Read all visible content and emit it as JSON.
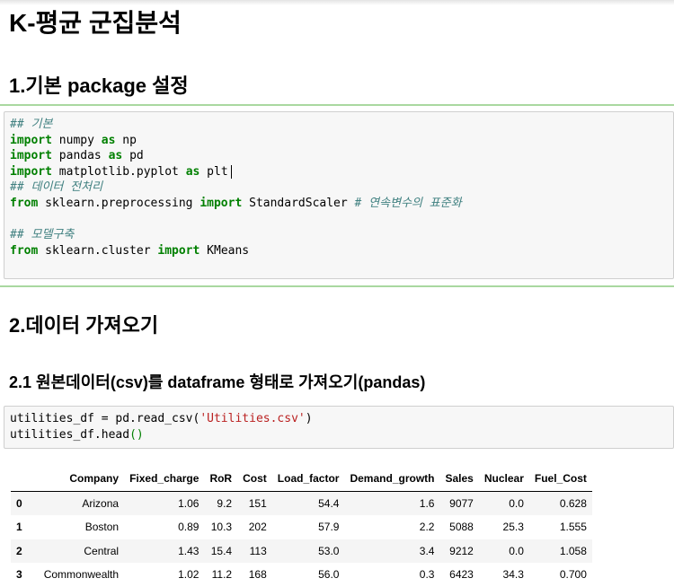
{
  "title": "K-평균 군집분석",
  "section1": {
    "heading": "1.기본 package 설정",
    "code": {
      "comment_basic": "## 기본",
      "line_numpy": [
        {
          "t": "import",
          "c": "kw"
        },
        {
          "t": " numpy "
        },
        {
          "t": "as",
          "c": "kw"
        },
        {
          "t": " np"
        }
      ],
      "line_pandas": [
        {
          "t": "import",
          "c": "kw"
        },
        {
          "t": " pandas "
        },
        {
          "t": "as",
          "c": "kw"
        },
        {
          "t": " pd"
        }
      ],
      "line_plt": [
        {
          "t": "import",
          "c": "kw"
        },
        {
          "t": " matplotlib.pyplot "
        },
        {
          "t": "as",
          "c": "kw"
        },
        {
          "t": " plt"
        }
      ],
      "comment_preprocess": "## 데이터 전처리",
      "line_scaler": [
        {
          "t": "from",
          "c": "kw"
        },
        {
          "t": " sklearn.preprocessing "
        },
        {
          "t": "import",
          "c": "kw"
        },
        {
          "t": " StandardScaler "
        },
        {
          "t": "# 연속변수의 표준화",
          "c": "cm"
        }
      ],
      "comment_model": "## 모델구축",
      "line_kmeans": [
        {
          "t": "from",
          "c": "kw"
        },
        {
          "t": " sklearn.cluster "
        },
        {
          "t": "import",
          "c": "kw"
        },
        {
          "t": " KMeans"
        }
      ]
    }
  },
  "section2": {
    "heading": "2.데이터 가져오기",
    "subheading": "2.1 원본데이터(csv)를 dataframe 형태로 가져오기(pandas)",
    "code": {
      "line_read": [
        {
          "t": "utilities_df = pd.read_csv("
        },
        {
          "t": "'Utilities.csv'",
          "c": "str"
        },
        {
          "t": ")"
        }
      ],
      "line_head": [
        {
          "t": "utilities_df.head"
        },
        {
          "t": "()",
          "c": "kw0"
        }
      ]
    }
  },
  "dataframe": {
    "columns": [
      "",
      "Company",
      "Fixed_charge",
      "RoR",
      "Cost",
      "Load_factor",
      "Demand_growth",
      "Sales",
      "Nuclear",
      "Fuel_Cost"
    ],
    "rows": [
      [
        "0",
        "Arizona",
        "1.06",
        "9.2",
        "151",
        "54.4",
        "1.6",
        "9077",
        "0.0",
        "0.628"
      ],
      [
        "1",
        "Boston",
        "0.89",
        "10.3",
        "202",
        "57.9",
        "2.2",
        "5088",
        "25.3",
        "1.555"
      ],
      [
        "2",
        "Central",
        "1.43",
        "15.4",
        "113",
        "53.0",
        "3.4",
        "9212",
        "0.0",
        "1.058"
      ],
      [
        "3",
        "Commonwealth",
        "1.02",
        "11.2",
        "168",
        "56.0",
        "0.3",
        "6423",
        "34.3",
        "0.700"
      ]
    ]
  },
  "colors": {
    "keyword": "#008000",
    "comment": "#408080",
    "string": "#ba2121",
    "cell_separator": "#a9d8a0"
  }
}
